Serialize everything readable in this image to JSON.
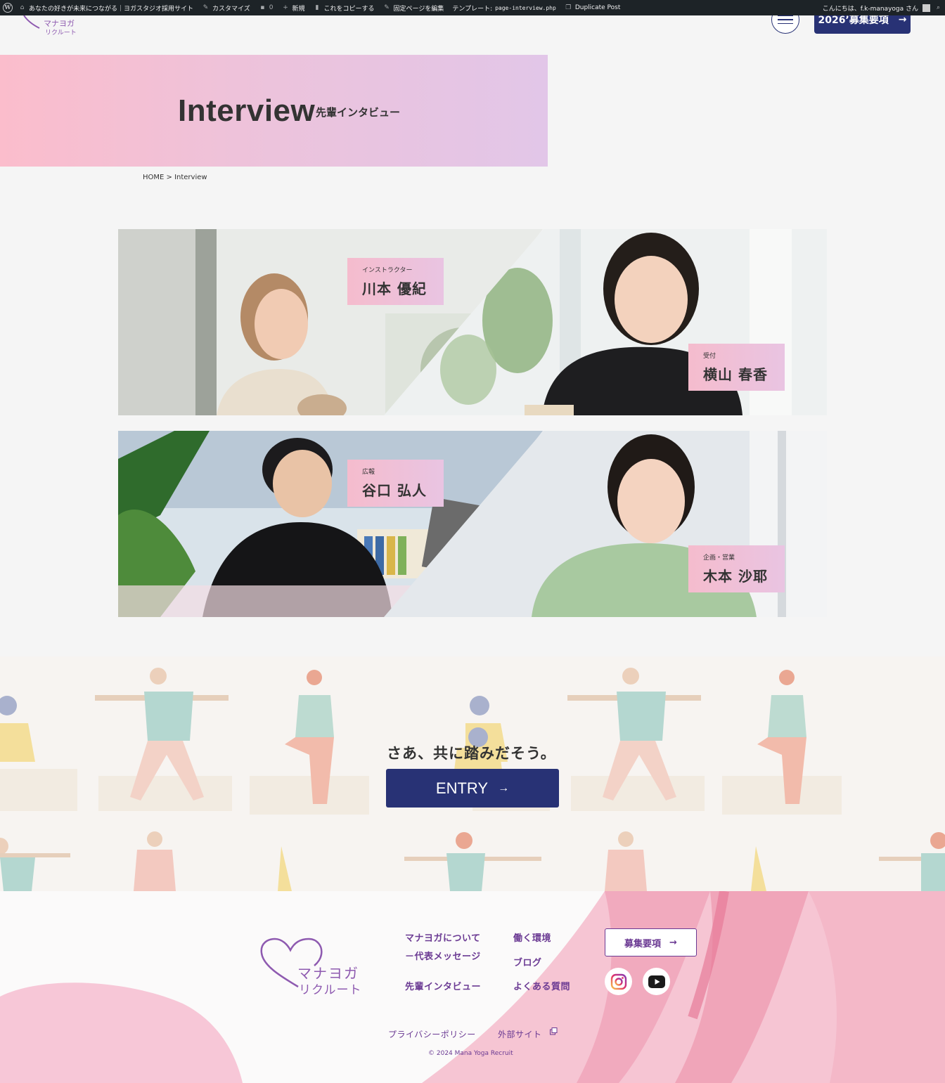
{
  "adminbar": {
    "site_name": "あなたの好きが未来につながる｜ヨガスタジオ採用サイト",
    "customize": "カスタマイズ",
    "comments": "0",
    "new": "新規",
    "copy": "これをコピーする",
    "edit_page": "固定ページを編集",
    "template_label": "テンプレート:",
    "template_file": "page-interview.php",
    "duplicate": "Duplicate Post",
    "greeting": "こんにちは、f.k-manayoga さん"
  },
  "header": {
    "logo_line1": "マナヨガ",
    "logo_line2": "リクルート",
    "recruit_label": "2026’募集要項",
    "arrow": "→"
  },
  "hero": {
    "title": "Interview",
    "subtitle": "先輩インタビュー"
  },
  "breadcrumb": "HOME > Interview",
  "interviews": [
    {
      "role": "インストラクター",
      "name": "川本 優紀"
    },
    {
      "role": "受付",
      "name": "横山 春香"
    },
    {
      "role": "広報",
      "name": "谷口 弘人"
    },
    {
      "role": "企画・営業",
      "name": "木本 沙耶"
    }
  ],
  "entry": {
    "catch": "さあ、共に踏みだそう。",
    "button_label": "ENTRY",
    "arrow": "→"
  },
  "footer": {
    "logo_line1": "マナヨガ",
    "logo_line2": "リクルート",
    "links": {
      "about": "マナヨガについて",
      "message": "－代表メッセージ",
      "interview": "先輩インタビュー",
      "environment": "働く環境",
      "blog": "ブログ",
      "faq": "よくある質問"
    },
    "recruit_label": "募集要項",
    "arrow": "→",
    "privacy": "プライバシーポリシー",
    "external": "外部サイト",
    "copyright": "© 2024 Mana Yoga Recruit"
  },
  "colors": {
    "navy": "#283275",
    "purple": "#6b3a93",
    "pink": "#f5bccd",
    "lavender": "#e2c6e8"
  }
}
